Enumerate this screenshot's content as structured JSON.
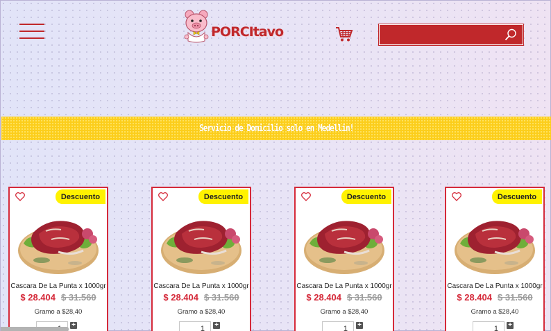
{
  "header": {
    "logo_text": "PORCItavo",
    "search": {
      "value": "",
      "placeholder": ""
    }
  },
  "banner": {
    "text": "Servicio de Domicilio solo en Medellin!"
  },
  "products": [
    {
      "badge": "Descuento",
      "name": "Cascara De La Punta x 1000gr",
      "price": "$ 28.404",
      "old_price": "$ 31.560",
      "unit_price": "Gramo a $28,40",
      "quantity": "1"
    },
    {
      "badge": "Descuento",
      "name": "Cascara De La Punta x 1000gr",
      "price": "$ 28.404",
      "old_price": "$ 31.560",
      "unit_price": "Gramo a $28,40",
      "quantity": "1"
    },
    {
      "badge": "Descuento",
      "name": "Cascara De La Punta x 1000gr",
      "price": "$ 28.404",
      "old_price": "$ 31.560",
      "unit_price": "Gramo a $28,40",
      "quantity": "1"
    },
    {
      "badge": "Descuento",
      "name": "Cascara De La Punta x 1000gr",
      "price": "$ 28.404",
      "old_price": "$ 31.560",
      "unit_price": "Gramo a $28,40",
      "quantity": "1"
    }
  ],
  "icons": {
    "menu": "hamburger-menu-icon",
    "cart": "shopping-cart-icon",
    "search": "search-icon",
    "favorite": "heart-icon",
    "increment": "plus-icon"
  },
  "colors": {
    "brand_red": "#c0282b",
    "banner_yellow": "#fcce1c",
    "badge_yellow": "#fff200",
    "card_border": "#d52a3a",
    "old_price_gray": "#9b9b9b"
  }
}
